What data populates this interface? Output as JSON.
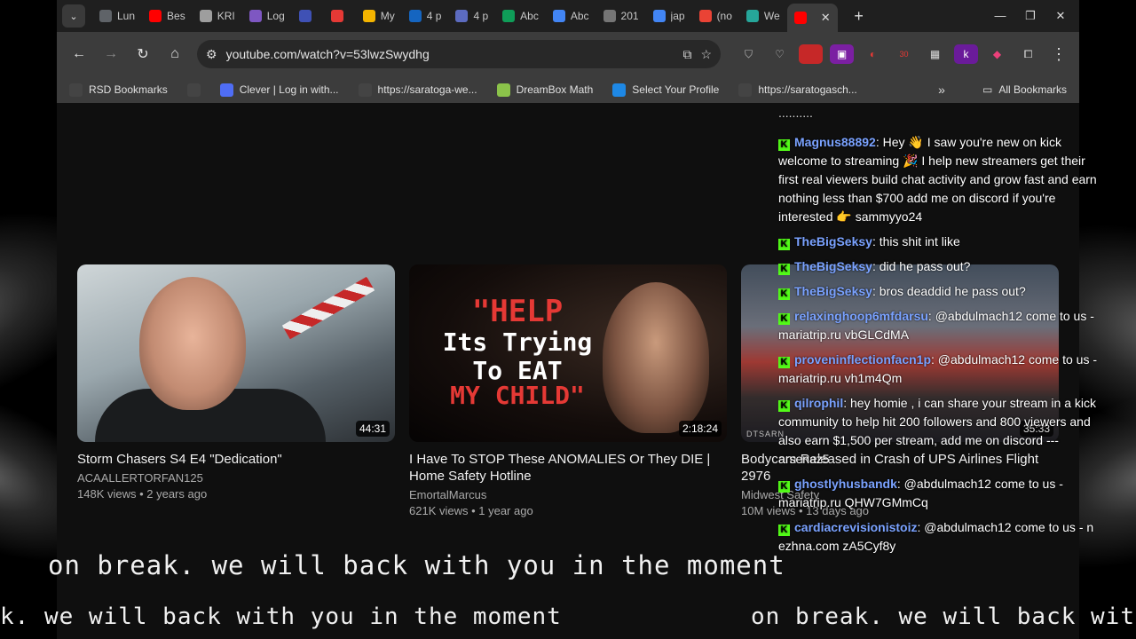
{
  "tabs": [
    {
      "label": "Lun",
      "color": "#5f6368"
    },
    {
      "label": "Bes",
      "color": "#ff0000"
    },
    {
      "label": "KRI",
      "color": "#9e9e9e"
    },
    {
      "label": "Log",
      "color": "#7e57c2"
    },
    {
      "label": "",
      "color": "#3f51b5"
    },
    {
      "label": "",
      "color": "#e53935"
    },
    {
      "label": "My",
      "color": "#f4b400"
    },
    {
      "label": "4 p",
      "color": "#1565c0"
    },
    {
      "label": "4 p",
      "color": "#5c6bc0"
    },
    {
      "label": "Abc",
      "color": "#0f9d58"
    },
    {
      "label": "Abc",
      "color": "#4285f4"
    },
    {
      "label": "201",
      "color": "#757575"
    },
    {
      "label": "jap",
      "color": "#4285f4"
    },
    {
      "label": "(no",
      "color": "#ea4335"
    },
    {
      "label": "We",
      "color": "#26a69a"
    }
  ],
  "active_tab": {
    "color": "#ff0000",
    "close": "✕"
  },
  "window_controls": {
    "minimize": "—",
    "restore": "❐",
    "close": "✕"
  },
  "toolbar": {
    "url": "youtube.com/watch?v=53lwzSwydhg",
    "extension_badge": "30"
  },
  "bookmarks": [
    {
      "label": "RSD Bookmarks",
      "icon": "folder-icon",
      "color": "#444"
    },
    {
      "label": "",
      "icon": "apps-grid-icon",
      "color": "#444"
    },
    {
      "label": "Clever | Log in with...",
      "icon": "clever-icon",
      "color": "#4f6df5"
    },
    {
      "label": "https://saratoga-we...",
      "icon": "globe-icon",
      "color": "#444"
    },
    {
      "label": "DreamBox Math",
      "icon": "dreambox-icon",
      "color": "#8bc34a"
    },
    {
      "label": "Select Your Profile",
      "icon": "profile-icon",
      "color": "#1e88e5"
    },
    {
      "label": "https://saratogasch...",
      "icon": "link-icon",
      "color": "#444"
    }
  ],
  "all_bookmarks": "All Bookmarks",
  "videos": [
    {
      "title": "Storm Chasers S4 E4 \"Dedication\"",
      "channel": "ACAALLERTORFAN125",
      "meta": "148K views • 2 years ago",
      "duration": "44:31"
    },
    {
      "title": "I Have To STOP These ANOMALIES Or They DIE | Home Safety Hotline",
      "channel": "EmortalMarcus",
      "meta": "621K views • 1 year ago",
      "duration": "2:18:24",
      "thumb_line1": "\"HELP",
      "thumb_line2": "Its Trying",
      "thumb_line3": "To EAT",
      "thumb_line4": "MY CHILD\""
    },
    {
      "title": "Bodycam Released in Crash of UPS Airlines Flight 2976",
      "channel": "Midwest Safety",
      "meta": "10M views • 13 days ago",
      "duration": "35:33",
      "brand": "DTSARN"
    }
  ],
  "chat": {
    "cut_top": "..........",
    "messages": [
      {
        "user": "Magnus88892",
        "text": ": Hey 👋 I saw you're new on kick welcome to streaming 🎉 I help new streamers get their first real viewers build chat activity and grow fast and earn nothing less than $700 add me on discord if you're interested 👉 sammyyo24"
      },
      {
        "user": "TheBigSeksy",
        "text": ": this shit int like"
      },
      {
        "user": "TheBigSeksy",
        "text": ": did he pass out?"
      },
      {
        "user": "TheBigSeksy",
        "text": ": bros deaddid he pass out?"
      },
      {
        "user": "relaxinghoop6mfdarsu",
        "text": ": @abdulmach12 come to us - mariatrip.ru vbGLCdMA"
      },
      {
        "user": "proveninflectionfacn1p",
        "text": ": @abdulmach12 come to us - mariatrip.ru vh1m4Qm"
      },
      {
        "user": "qilrophil",
        "text": ": hey homie , i can share your stream in a kick community to help hit 200 followers and 800 viewers and also earn $1,500 per stream, add me on discord --- arsenaz5"
      },
      {
        "user": "ghostlyhusbandk",
        "text": ": @abdulmach12 come to us - mariatrip.ru QHW7GMmCq"
      },
      {
        "user": "cardiacrevisionistoiz",
        "text": ": @abdulmach12 come to us - n ezhna.com zA5Cyf8y"
      }
    ]
  },
  "captions": {
    "big": "on break. we will back with you in the moment",
    "ticker1": "k. we will back with you in the moment",
    "ticker2": "on break. we will back wit"
  }
}
